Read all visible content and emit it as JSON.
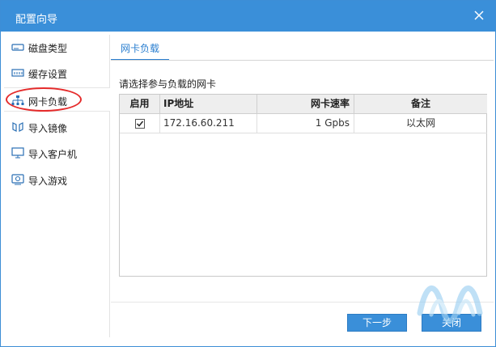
{
  "window": {
    "title": "配置向导"
  },
  "sidebar": {
    "items": [
      {
        "label": "磁盘类型",
        "icon": "disk-icon"
      },
      {
        "label": "缓存设置",
        "icon": "memory-icon"
      },
      {
        "label": "网卡负载",
        "icon": "network-icon",
        "active": true
      },
      {
        "label": "导入镜像",
        "icon": "image-icon"
      },
      {
        "label": "导入客户机",
        "icon": "monitor-icon"
      },
      {
        "label": "导入游戏",
        "icon": "game-icon"
      }
    ]
  },
  "main": {
    "tab": "网卡负载",
    "hint": "请选择参与负载的网卡",
    "table": {
      "columns": [
        "启用",
        "IP地址",
        "网卡速率",
        "备注"
      ],
      "rows": [
        {
          "enabled": true,
          "ip": "172.16.60.211",
          "speed": "1 Gpbs",
          "note": "以太网"
        }
      ]
    }
  },
  "footer": {
    "next_label": "下一步",
    "close_label": "关闭"
  },
  "colors": {
    "accent": "#3a8fd9",
    "highlight_ring": "#e52b2b"
  }
}
